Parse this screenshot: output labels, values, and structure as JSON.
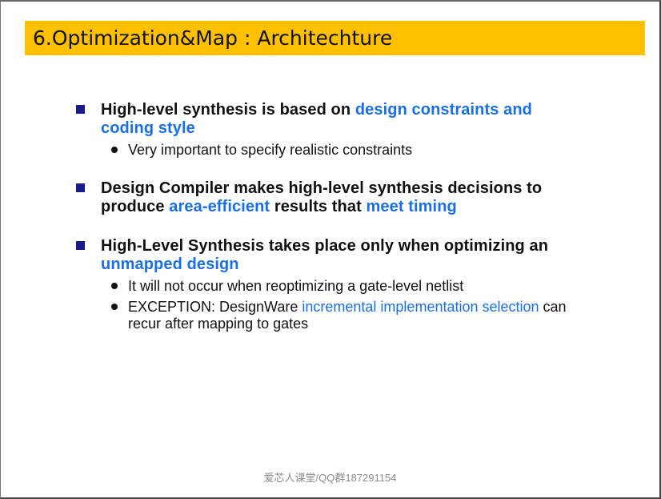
{
  "slide": {
    "title": "6.Optimization&Map : Architechture",
    "footer": "爱芯人课堂/QQ群187291154"
  },
  "bullets": [
    {
      "parts": [
        {
          "text": "High-level synthesis is based on ",
          "highlight": false
        },
        {
          "text": "design constraints and coding style",
          "highlight": true
        }
      ],
      "sub": [
        {
          "parts": [
            {
              "text": "Very important to specify realistic constraints",
              "highlight": false
            }
          ]
        }
      ]
    },
    {
      "parts": [
        {
          "text": "Design Compiler makes high-level synthesis decisions to produce ",
          "highlight": false
        },
        {
          "text": "area-efficient",
          "highlight": true
        },
        {
          "text": " results that ",
          "highlight": false
        },
        {
          "text": "meet timing",
          "highlight": true
        }
      ],
      "sub": []
    },
    {
      "parts": [
        {
          "text": "High-Level Synthesis takes place only when optimizing an ",
          "highlight": false
        },
        {
          "text": "unmapped design",
          "highlight": true
        }
      ],
      "sub": [
        {
          "parts": [
            {
              "text": "It will not occur when reoptimizing a gate-level netlist",
              "highlight": false
            }
          ]
        },
        {
          "parts": [
            {
              "text": "EXCEPTION: DesignWare ",
              "highlight": false
            },
            {
              "text": "incremental implementation selection",
              "highlight": true
            },
            {
              "text": " can recur after mapping to gates",
              "highlight": false
            }
          ]
        }
      ]
    }
  ],
  "colors": {
    "title_bar": "#ffc000",
    "highlight": "#1a6fe8",
    "bullet_square": "#1a1a8c"
  }
}
